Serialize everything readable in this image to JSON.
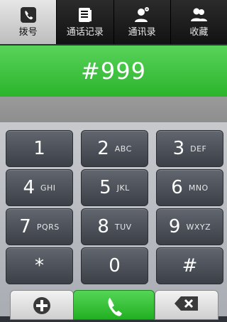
{
  "tabs": [
    {
      "label": "拨号",
      "icon": "dialpad-phone-icon",
      "active": true
    },
    {
      "label": "通话记录",
      "icon": "call-log-icon",
      "active": false
    },
    {
      "label": "通讯录",
      "icon": "contacts-icon",
      "active": false
    },
    {
      "label": "收藏",
      "icon": "favorites-icon",
      "active": false
    }
  ],
  "display": {
    "number": "#999"
  },
  "keys": [
    {
      "num": "1",
      "letters": ""
    },
    {
      "num": "2",
      "letters": "ABC"
    },
    {
      "num": "3",
      "letters": "DEF"
    },
    {
      "num": "4",
      "letters": "GHI"
    },
    {
      "num": "5",
      "letters": "JKL"
    },
    {
      "num": "6",
      "letters": "MNO"
    },
    {
      "num": "7",
      "letters": "PQRS"
    },
    {
      "num": "8",
      "letters": "TUV"
    },
    {
      "num": "9",
      "letters": "WXYZ"
    },
    {
      "num": "*",
      "letters": ""
    },
    {
      "num": "0",
      "letters": ""
    },
    {
      "num": "#",
      "letters": ""
    }
  ],
  "actions": {
    "add_icon": "add-contact-icon",
    "call_icon": "call-icon",
    "delete_icon": "backspace-icon"
  },
  "colors": {
    "display_green": "#3cc43d",
    "key_dark": "#4a4e56",
    "tab_active": "#d6d6d6"
  }
}
